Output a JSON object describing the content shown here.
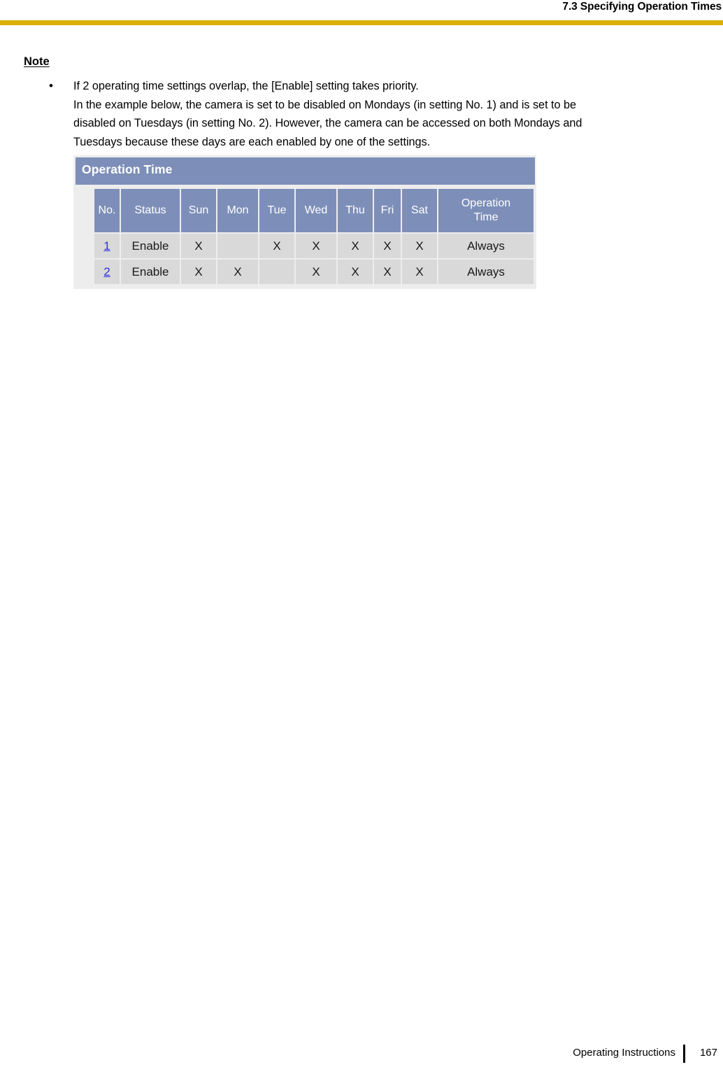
{
  "header": {
    "title": "7.3 Specifying Operation Times",
    "rule_color": "#d9af07"
  },
  "note": {
    "heading": "Note",
    "bullet_glyph": "•",
    "lines": [
      "If 2 operating time settings overlap, the [Enable] setting takes priority.",
      "In the example below, the camera is set to be disabled on Mondays (in setting No. 1) and is set to be",
      "disabled on Tuesdays (in setting No. 2). However, the camera can be accessed on both Mondays and",
      "Tuesdays because these days are each enabled by one of the settings."
    ]
  },
  "operation_time_table": {
    "title": "Operation Time",
    "header_bg": "#7d8fb8",
    "cell_bg": "#d9d9d9",
    "link_color": "#2f2fdc",
    "columns": [
      "No.",
      "Status",
      "Sun",
      "Mon",
      "Tue",
      "Wed",
      "Thu",
      "Fri",
      "Sat",
      "Operation Time"
    ],
    "operation_time_header_line1": "Operation",
    "operation_time_header_line2": "Time",
    "rows": [
      {
        "no": "1",
        "status": "Enable",
        "sun": "X",
        "mon": "",
        "tue": "X",
        "wed": "X",
        "thu": "X",
        "fri": "X",
        "sat": "X",
        "operation_time": "Always"
      },
      {
        "no": "2",
        "status": "Enable",
        "sun": "X",
        "mon": "X",
        "tue": "",
        "wed": "X",
        "thu": "X",
        "fri": "X",
        "sat": "X",
        "operation_time": "Always"
      }
    ]
  },
  "footer": {
    "label": "Operating Instructions",
    "page_number": "167"
  }
}
